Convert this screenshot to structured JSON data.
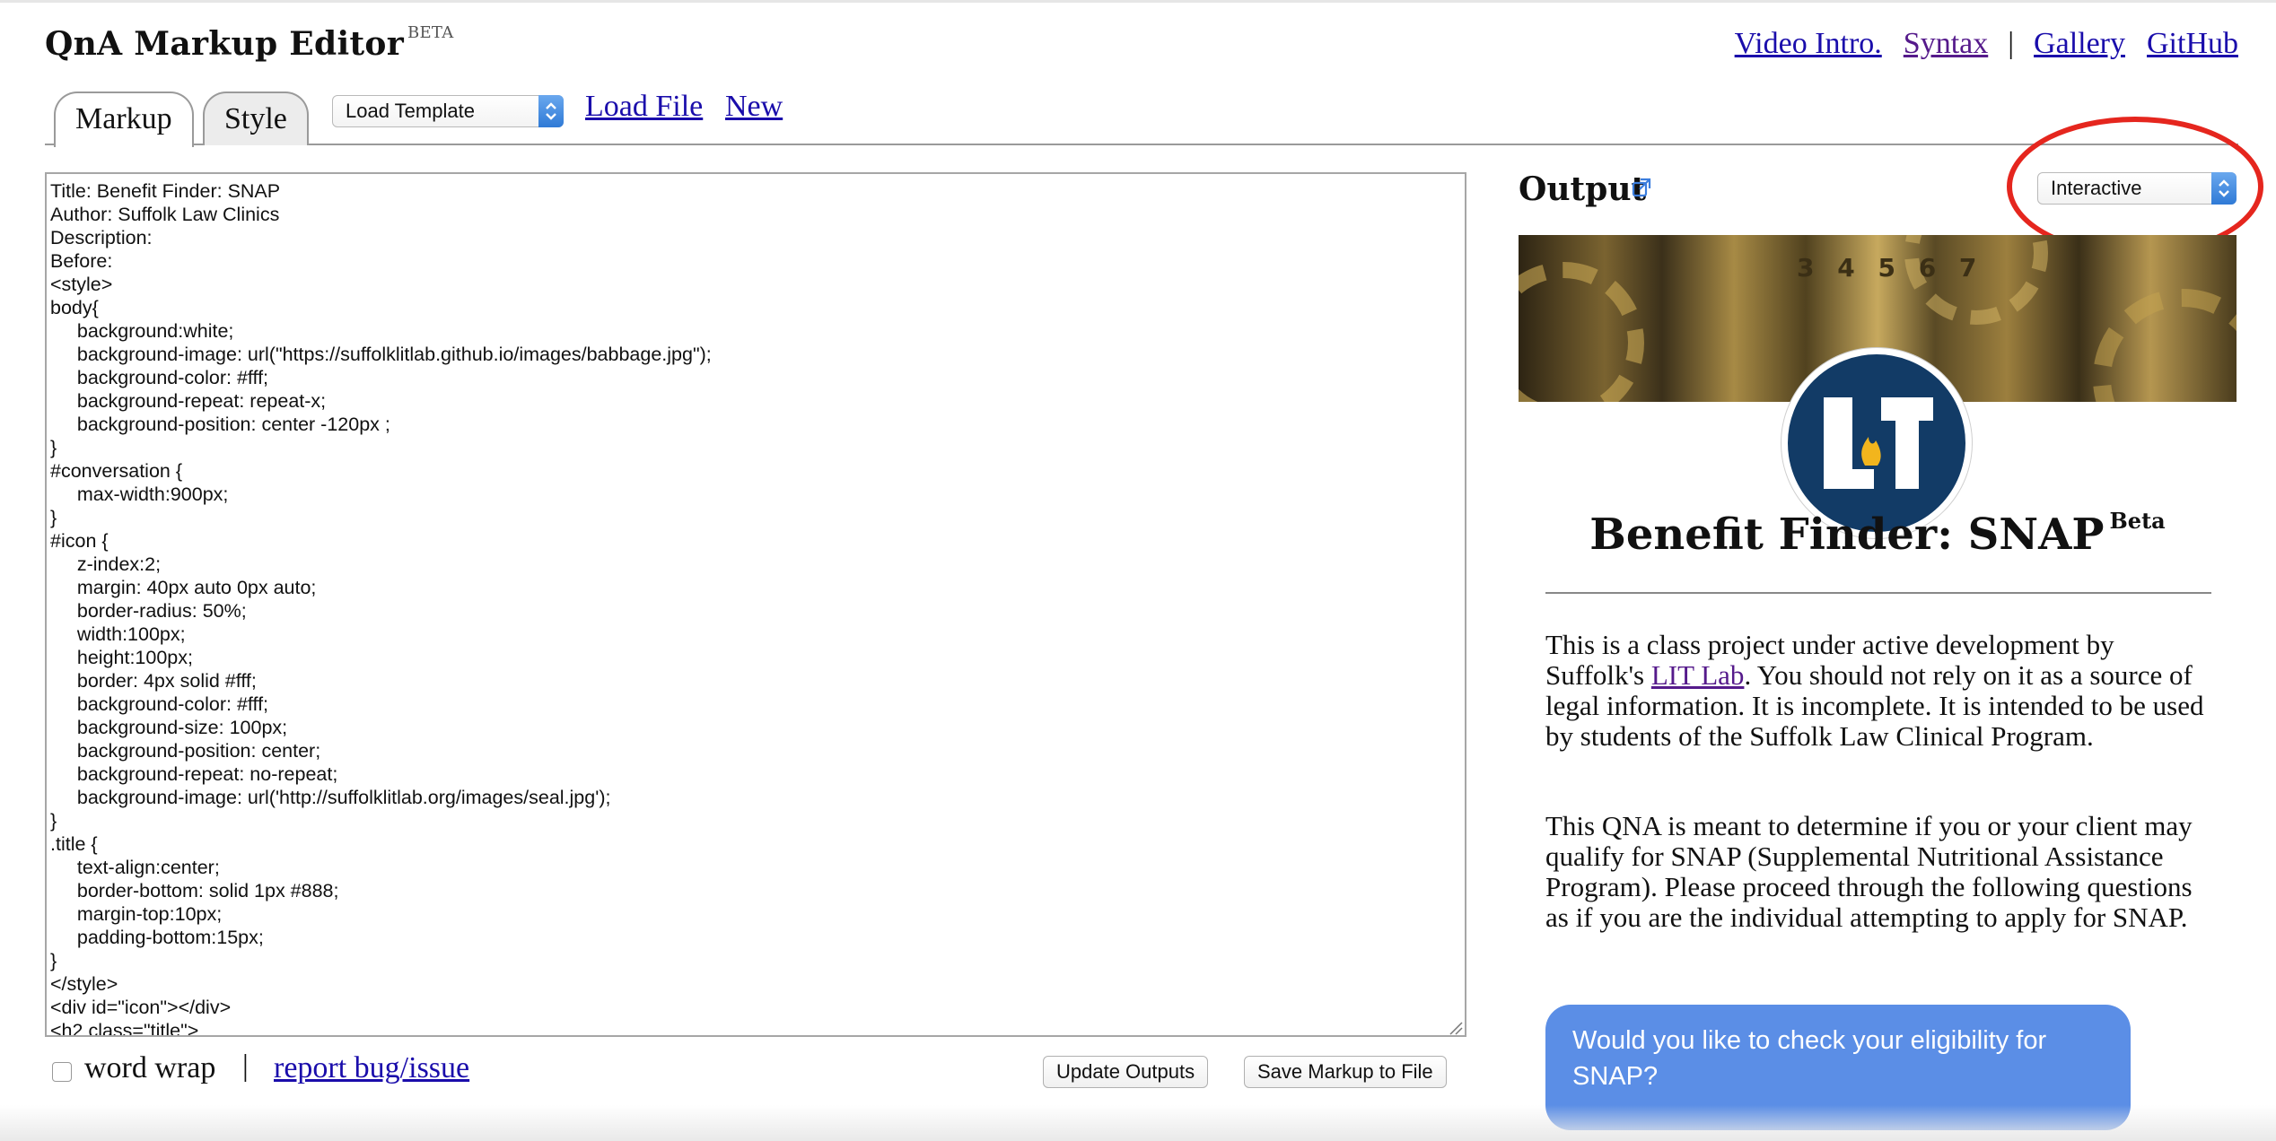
{
  "header": {
    "app_title": "QnA Markup Editor",
    "badge": "BETA",
    "nav": {
      "video_intro": "Video Intro.",
      "syntax": "Syntax",
      "separator": "|",
      "gallery": "Gallery",
      "github": "GitHub"
    }
  },
  "toolbar": {
    "tabs": [
      {
        "label": "Markup",
        "active": true
      },
      {
        "label": "Style",
        "active": false
      }
    ],
    "template_select": "Load Template",
    "load_file": "Load File",
    "new": "New"
  },
  "editor": {
    "lines": [
      "Title: Benefit Finder: SNAP",
      "Author: Suffolk Law Clinics",
      "Description:",
      "Before:",
      "<style>",
      "body{",
      "\tbackground:white;",
      "\tbackground-image: url(\"https://suffolklitlab.github.io/images/babbage.jpg\");",
      "\tbackground-color: #fff;",
      "\tbackground-repeat: repeat-x;",
      "\tbackground-position: center -120px ;",
      "}",
      "#conversation {",
      "\tmax-width:900px;",
      "}",
      "#icon {",
      "\tz-index:2;",
      "\tmargin: 40px auto 0px auto;",
      "\tborder-radius: 50%;",
      "\twidth:100px;",
      "\theight:100px;",
      "\tborder: 4px solid #fff;",
      "\tbackground-color: #fff;",
      "\tbackground-size: 100px;",
      "\tbackground-position: center;",
      "\tbackground-repeat: no-repeat;",
      "\tbackground-image: url('http://suffolklitlab.org/images/seal.jpg');",
      "}",
      ".title {",
      "\ttext-align:center;",
      "\tborder-bottom: solid 1px #888;",
      "\tmargin-top:10px;",
      "\tpadding-bottom:15px;",
      "}",
      "</style>",
      "<div id=\"icon\"></div>",
      "<h2 class=\"title\">"
    ]
  },
  "footer": {
    "word_wrap_label": "word wrap",
    "word_wrap_checked": false,
    "separator": "|",
    "report_link": "report bug/issue",
    "update_button": "Update Outputs",
    "save_button": "Save Markup to File"
  },
  "output": {
    "title": "Output",
    "mode_select": "Interactive",
    "banner_digits": "3 4 5 6 7",
    "qna": {
      "title": "Benefit Finder: SNAP",
      "badge": "Beta",
      "p1_before": "This is a class project under active development by Suffolk's ",
      "p1_link": "LIT Lab",
      "p1_after": ". You should not rely on it as a source of legal information. It is incomplete. It is intended to be used by students of the Suffolk Law Clinical Program.",
      "p2": "This QNA is meant to determine if you or your client may qualify for SNAP (Supplemental Nutritional Assistance Program). Please proceed through the following questions as if you are the individual attempting to apply for SNAP.",
      "question": "Would you like to check your eligibility for SNAP?"
    }
  },
  "colors": {
    "link": "#1a0dab",
    "visited_link": "#551a8b",
    "bubble": "#5b8ee6",
    "logo_navy": "#123b66",
    "highlight_circle": "#e5261e"
  },
  "icons": [
    "external-link-icon",
    "select-arrow-icon",
    "resize-grip-icon",
    "lit-lab-logo"
  ]
}
